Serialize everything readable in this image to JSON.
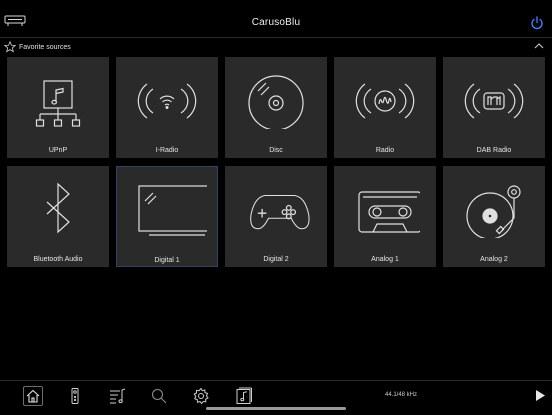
{
  "header": {
    "title": "CarusoBlu"
  },
  "favorites": {
    "label": "Favorite sources"
  },
  "sources": [
    {
      "label": "UPnP",
      "icon": "upnp-icon"
    },
    {
      "label": "I-Radio",
      "icon": "internet-radio-icon"
    },
    {
      "label": "Disc",
      "icon": "disc-icon"
    },
    {
      "label": "Radio",
      "icon": "radio-icon"
    },
    {
      "label": "DAB Radio",
      "icon": "dab-radio-icon"
    },
    {
      "label": "Bluetooth Audio",
      "icon": "bluetooth-icon"
    },
    {
      "label": "Digital 1",
      "icon": "digital-tv-icon",
      "selected": true
    },
    {
      "label": "Digital 2",
      "icon": "gamepad-icon"
    },
    {
      "label": "Analog 1",
      "icon": "cassette-icon"
    },
    {
      "label": "Analog 2",
      "icon": "turntable-icon"
    }
  ],
  "footer": {
    "sample_rate": "44.1/48 kHz",
    "buttons": [
      "home-icon",
      "remote-icon",
      "playlist-icon",
      "search-icon",
      "gear-icon",
      "music-library-icon",
      "play-icon"
    ]
  },
  "colors": {
    "background": "#000000",
    "tile": "#2a2a2a",
    "selected_border": "#2e4270",
    "accent": "#3d7bff"
  }
}
